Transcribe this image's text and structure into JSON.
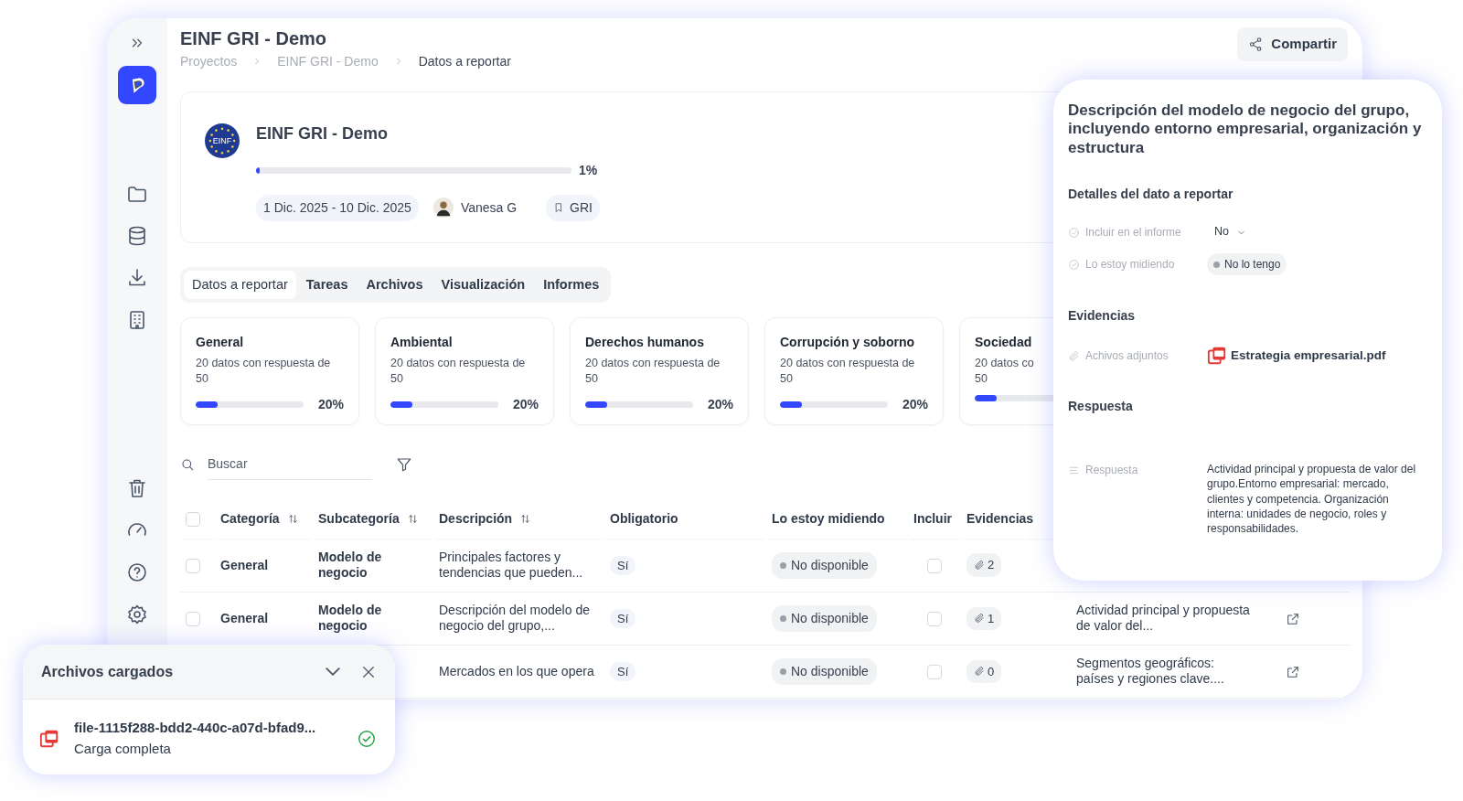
{
  "header": {
    "title": "EINF GRI - Demo",
    "share_button": "Compartir"
  },
  "breadcrumb": [
    {
      "label": "Proyectos",
      "current": false
    },
    {
      "label": "EINF GRI - Demo",
      "current": false
    },
    {
      "label": "Datos a reportar",
      "current": true
    }
  ],
  "project_card": {
    "emblem_text": "EINF",
    "name": "EINF GRI - Demo",
    "level": 0.01,
    "percent": "1%",
    "dates": "1 Dic. 2025 - 10 Dic. 2025",
    "owner": "Vanesa G",
    "tag": "GRI"
  },
  "tabs": [
    {
      "label": "Datos a reportar",
      "selected": true
    },
    {
      "label": "Tareas",
      "selected": false
    },
    {
      "label": "Archivos",
      "selected": false
    },
    {
      "label": "Visualización",
      "selected": false
    },
    {
      "label": "Informes",
      "selected": false
    }
  ],
  "categories": [
    {
      "title": "General",
      "description": "20 datos con respuesta de\n50",
      "level": 0.2,
      "percent": "20%"
    },
    {
      "title": "Ambiental",
      "description": "20 datos con respuesta de\n50",
      "level": 0.2,
      "percent": "20%"
    },
    {
      "title": "Derechos humanos",
      "description": "20 datos con respuesta de\n50",
      "level": 0.2,
      "percent": "20%"
    },
    {
      "title": "Corrupción y soborno",
      "description": "20 datos con respuesta de\n50",
      "level": 0.2,
      "percent": "20%"
    },
    {
      "title": "Sociedad",
      "description": "20 datos co\n50",
      "level": 0.2
    }
  ],
  "search": {
    "placeholder": "Buscar"
  },
  "table": {
    "all_selected": false,
    "columns": [
      {
        "label": "Categoría",
        "sortable": true
      },
      {
        "label": "Subcategoría",
        "sortable": true
      },
      {
        "label": "Descripción",
        "sortable": true
      },
      {
        "label": "Obligatorio",
        "sortable": false
      },
      {
        "label": "Lo estoy midiendo",
        "sortable": false
      },
      {
        "label": "Incluir",
        "sortable": false
      },
      {
        "label": "Evidencias",
        "sortable": false
      }
    ],
    "rows": [
      {
        "selected": false,
        "category": "General",
        "subcategory": "Modelo de negocio",
        "description": "Principales factores y tendencias que pueden...",
        "mandatory": "Sí",
        "measuring": "No disponible",
        "include": false,
        "evidences": "2"
      },
      {
        "selected": false,
        "category": "General",
        "subcategory": "Modelo de negocio",
        "description": "Descripción del modelo de negocio del grupo,...",
        "mandatory": "Sí",
        "measuring": "No disponible",
        "include": false,
        "evidences": "1",
        "response": "Actividad principal y propuesta de valor del...",
        "link": true
      },
      {
        "description": "Mercados en los que opera",
        "mandatory": "Sí",
        "measuring": "No disponible",
        "include": false,
        "evidences": "0",
        "response": "Segmentos geográficos: países y regiones clave....",
        "link": true
      }
    ]
  },
  "detail_panel": {
    "title": "Descripción del modelo de negocio del grupo, incluyendo entorno empresarial, organización y estructura",
    "sections": [
      {
        "heading": "Detalles del dato a reportar",
        "fields": [
          {
            "kind": "select",
            "label": "Incluir en el informe",
            "value": "No"
          },
          {
            "kind": "status",
            "label": "Lo estoy midiendo",
            "value": "No lo tengo"
          }
        ]
      },
      {
        "heading": "Evidencias",
        "fields": [
          {
            "kind": "file",
            "label": "Achivos adjuntos",
            "value": "Estrategia empresarial.pdf"
          }
        ]
      },
      {
        "heading": "Respuesta",
        "fields": [
          {
            "kind": "text",
            "label": "Respuesta",
            "value": "Actividad principal y propuesta de valor del grupo.Entorno empresarial: mercado, clientes y competencia. Organización interna: unidades de negocio, roles y responsabilidades."
          }
        ]
      }
    ]
  },
  "uploads": {
    "title": "Archivos cargados",
    "files": [
      {
        "name": "file-1115f288-bdd2-440c-a07d-bfad9...",
        "status": "Carga completa",
        "done": true
      }
    ]
  }
}
